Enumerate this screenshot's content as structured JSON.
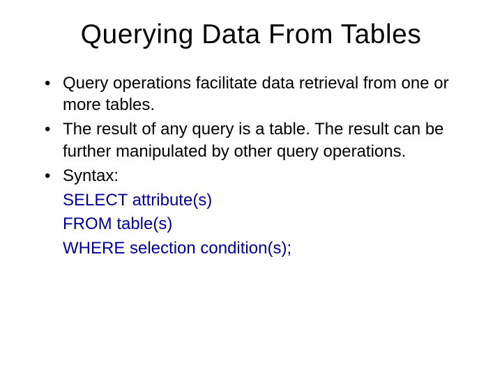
{
  "title": "Querying Data From Tables",
  "bullets": [
    "Query operations facilitate data retrieval from one or more tables.",
    "The result of any query is a table. The result can be further manipulated by other query operations.",
    "Syntax:"
  ],
  "syntax": {
    "line1": "SELECT attribute(s)",
    "line2": "FROM table(s)",
    "line3": "WHERE selection condition(s);"
  }
}
